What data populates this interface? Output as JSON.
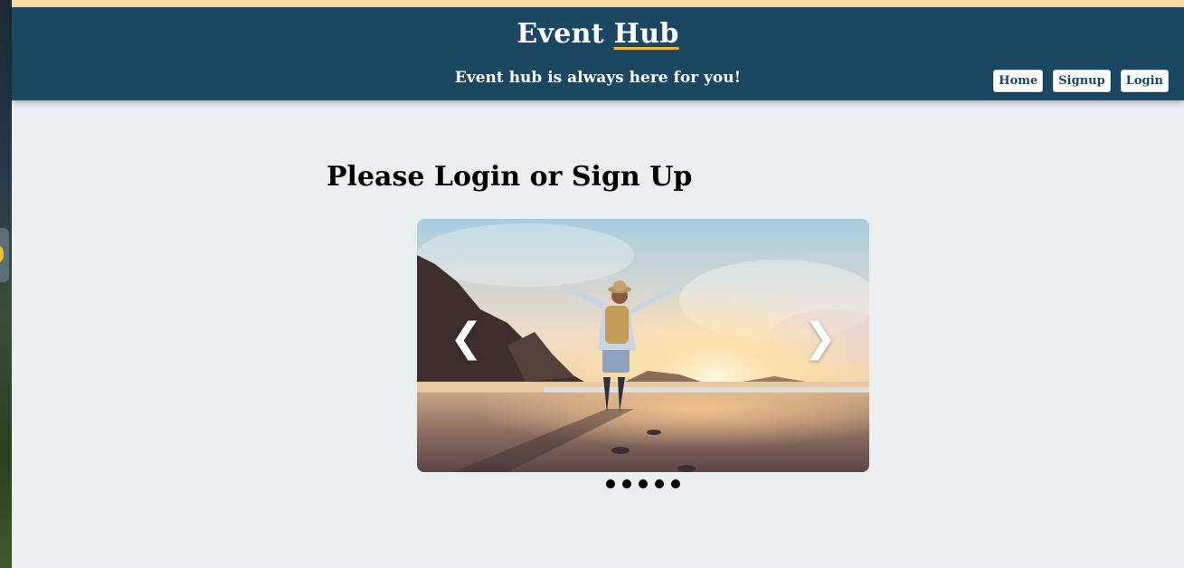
{
  "header": {
    "brand_first": "Event",
    "brand_second": "Hub",
    "tagline": "Event hub is always here for you!",
    "nav": [
      {
        "label": "Home"
      },
      {
        "label": "Signup"
      },
      {
        "label": "Login"
      }
    ]
  },
  "main": {
    "title": "Please Login or Sign Up",
    "carousel": {
      "prev_icon": "❮",
      "next_icon": "❯",
      "slide_count": 5,
      "image": "person-with-raised-arms-on-beach-at-sunset"
    }
  },
  "colors": {
    "header_bg": "#1b4763",
    "top_accent": "#fbd9a7",
    "underline_accent": "#f3b33d",
    "page_bg": "#eceff2"
  }
}
